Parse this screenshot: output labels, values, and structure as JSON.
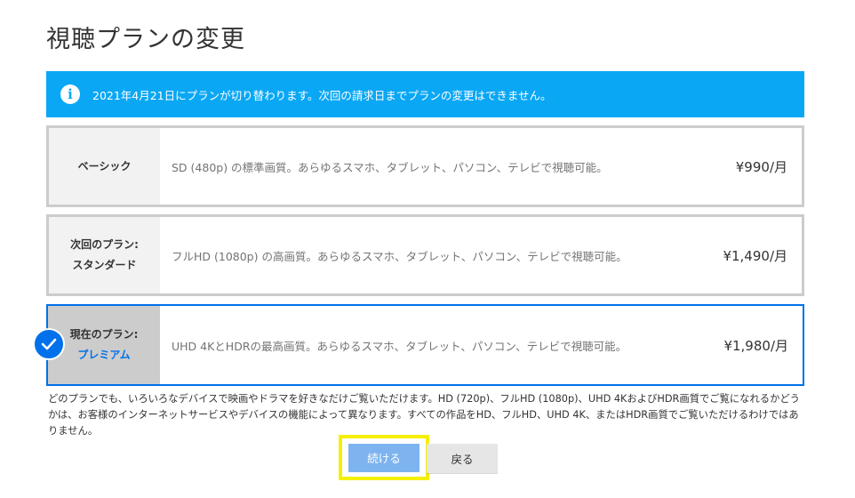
{
  "page": {
    "title": "視聴プランの変更"
  },
  "banner": {
    "icon": "info-icon",
    "text": "2021年4月21日にプランが切り替わります。次回の請求日までプランの変更はできません。",
    "color": "#0aa7f5"
  },
  "plans": [
    {
      "label_line1": "ベーシック",
      "label_line2": "",
      "description": "SD (480p) の標準画質。あらゆるスマホ、タブレット、パソコン、テレビで視聴可能。",
      "price": "¥990/月",
      "selected": false
    },
    {
      "label_line1": "次回のプラン:",
      "label_line2": "スタンダード",
      "description": "フルHD (1080p) の高画質。あらゆるスマホ、タブレット、パソコン、テレビで視聴可能。",
      "price": "¥1,490/月",
      "selected": false
    },
    {
      "label_line1": "現在のプラン:",
      "label_line2": "プレミアム",
      "description": "UHD 4KとHDRの最高画質。あらゆるスマホ、タブレット、パソコン、テレビで視聴可能。",
      "price": "¥1,980/月",
      "selected": true
    }
  ],
  "selection": {
    "icon": "checkmark-icon",
    "color": "#0071eb"
  },
  "footnote": "どのプランでも、いろいろなデバイスで映画やドラマを好きなだけご覧いただけます。HD (720p)、フルHD (1080p)、UHD 4KおよびHDR画質でご覧になれるかどうかは、お客様のインターネットサービスやデバイスの機能によって異なります。すべての作品をHD、フルHD、UHD 4K、またはHDR画質でご覧いただけるわけではありません。",
  "actions": {
    "continue_label": "続ける",
    "back_label": "戻る",
    "highlight_color": "#f5f000"
  }
}
